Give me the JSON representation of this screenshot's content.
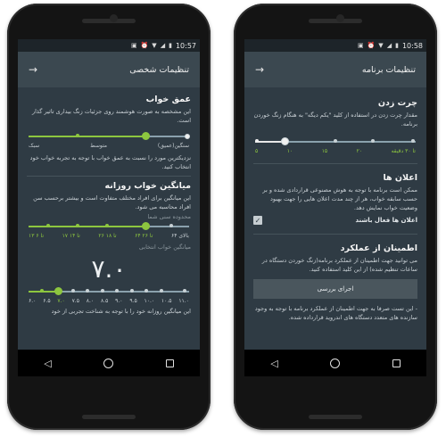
{
  "status": {
    "time": "10:57",
    "time_right": "10:58"
  },
  "left": {
    "title": "تنظیمات شخصی",
    "depth": {
      "title": "عمق خواب",
      "desc": "این مشخصه به صورت هوشمند روی جزئیات زنگ بیداری تاثیر گذار است.",
      "labels": [
        "سنگین(عمیق)",
        "متوسط",
        "سبک"
      ],
      "selected_fraction": 0.55,
      "note": "نزدیکترین مورد را نسبت به عمق خواب با توجه به تجربه خواب خود انتخاب کنید."
    },
    "avg": {
      "title": "میانگین خواب روزانه",
      "desc": "این میانگین برای افراد مختلف متفاوت است و بیشتر برحسب سن افراد محاسبه می شود.",
      "age_label": "محدوده سنی شما",
      "age_labels": [
        "بالای ۶۴",
        "۶۴ تا ۲۶",
        "۲۶ تا ۱۸",
        "۱۸ تا ۱۴",
        "۱۷ تا ۱۴",
        "۱۳ تا ۶"
      ],
      "age_fraction": 0.28,
      "chosen_label": "میانگین خواب انتخابی",
      "chosen_value": "۷.۰",
      "value_labels": [
        "۶.۰",
        "۶.۵",
        "۷.۰",
        "۷.۵",
        "۸.۰",
        "۸.۵",
        "۹.۰",
        "۹.۵",
        "۱۰.۰",
        "۱۰.۵",
        "۱۱.۰"
      ],
      "value_fraction": 0.2,
      "footer": "این میانگین روزانه خود را با توجه به شناخت تجربی از خود"
    }
  },
  "right": {
    "title": "تنظیمات برنامه",
    "snooze": {
      "title": "چرت زدن",
      "desc": "مقدار چرت زدن در استفاده از کلید \"یکم دیگه\" به هنگام زنگ خوردن برنامه.",
      "labels": [
        "تا ۳۰ دقیقه",
        "۲۰",
        "۱۵",
        "۱۰",
        "۵"
      ],
      "fraction": 0.2
    },
    "notices": {
      "title": "اعلان ها",
      "desc": "ممکن است برنامه با توجه به هوش مصنوعی قراردادی شده و بر حسب سابقه خواب، هر از چند مدت اعلان هایی را جهت بهبود وضعیت خواب نمایش دهد.",
      "check_label": "اعلان ها فعال باشند",
      "checked": true
    },
    "perf": {
      "title": "اطمینان از عملکرد",
      "desc": "می توانید جهت اطمینان از عملکرد برنامه(زنگ خوردن دستگاه در ساعات تنظیم شده) از این کلید استفاده کنید.",
      "button": "اجرای بررسی",
      "footer": "- این تست صرفا به جهت اطمینان از عملکرد برنامه با توجه به وجود سازنده های متعدد دستگاه های اندروید قرارداده شده."
    }
  }
}
